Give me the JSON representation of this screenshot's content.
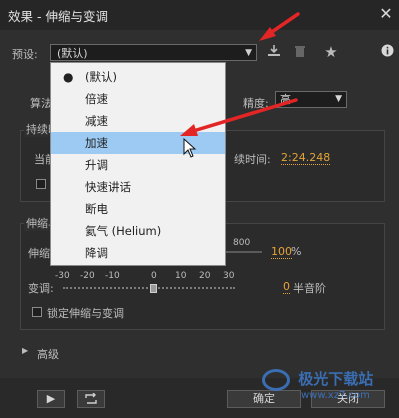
{
  "window": {
    "title": "效果 - 伸缩与变调",
    "close_glyph": "✕"
  },
  "preset": {
    "label": "预设:",
    "value": "(默认)",
    "icons": [
      "download-icon",
      "trash-icon",
      "star-icon",
      "info-icon"
    ]
  },
  "dropdown": {
    "items": [
      {
        "label": "(默认)",
        "selected": true
      },
      {
        "label": "倍速"
      },
      {
        "label": "减速"
      },
      {
        "label": "加速",
        "highlighted": true
      },
      {
        "label": "升调"
      },
      {
        "label": "快速讲话"
      },
      {
        "label": "断电"
      },
      {
        "label": "氦气 (Helium)"
      },
      {
        "label": "降调"
      }
    ]
  },
  "algorithm": {
    "label": "算法",
    "precision_label": "精度:",
    "precision_value": "高"
  },
  "duration": {
    "section_label": "持续时",
    "current_label": "当前",
    "new_duration_label": "续时间:",
    "new_duration_value": "2:24.248"
  },
  "stretch_pitch": {
    "section_label": "伸缩与",
    "stretch_label": "伸缩",
    "stretch_max_tick": "800",
    "stretch_value": "100",
    "stretch_unit": "%",
    "pitch_label": "变调:",
    "pitch_ticks": [
      "-30",
      "-20",
      "-10",
      "0",
      "10",
      "20",
      "30"
    ],
    "pitch_value": "0",
    "pitch_unit": "半音阶",
    "lock_label": "锁定伸缩与变调"
  },
  "advanced": {
    "label": "高级"
  },
  "footer": {
    "ok": "确定",
    "close": "关闭"
  },
  "watermark": {
    "text": "极光下载站",
    "url": "www.xz7.com"
  },
  "colors": {
    "accent_orange": "#e5a336",
    "highlight": "#9ccaf3",
    "arrow": "#e32525"
  }
}
